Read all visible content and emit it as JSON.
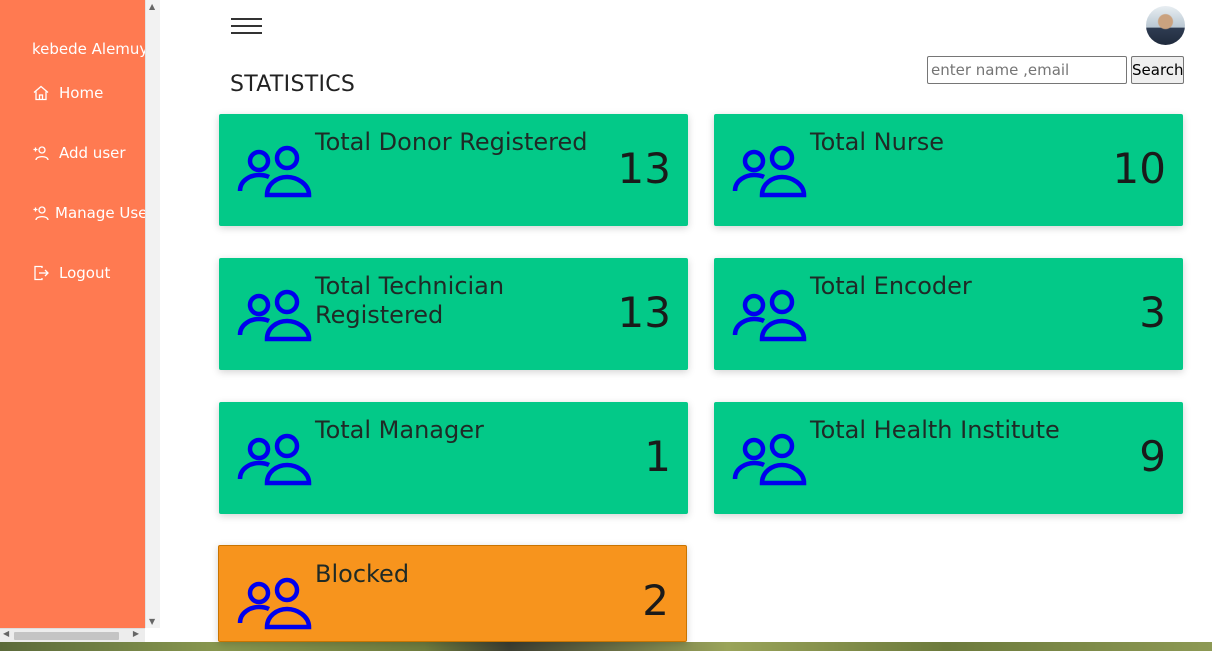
{
  "sidebar": {
    "username": "kebede Alemuyie",
    "items": [
      {
        "label": "Home",
        "icon": "home-icon"
      },
      {
        "label": "Add user",
        "icon": "add-user-icon"
      },
      {
        "label": "Manage Users",
        "icon": "manage-users-icon"
      },
      {
        "label": "Logout",
        "icon": "logout-icon"
      }
    ]
  },
  "header": {
    "title": "STATISTICS",
    "search_placeholder": "enter name ,email",
    "search_button": "Search"
  },
  "cards": [
    {
      "label": "Total Donor Registered",
      "count": "13",
      "icon": "users-icon"
    },
    {
      "label": "Total Nurse",
      "count": "10",
      "icon": "users-icon"
    },
    {
      "label": "Total Technician Registered",
      "count": "13",
      "icon": "users-icon"
    },
    {
      "label": "Total Encoder",
      "count": "3",
      "icon": "users-icon"
    },
    {
      "label": "Total Manager",
      "count": "1",
      "icon": "users-icon"
    },
    {
      "label": "Total Health Institute",
      "count": "9",
      "icon": "users-icon"
    },
    {
      "label": "Blocked",
      "count": "2",
      "icon": "users-icon"
    }
  ],
  "colors": {
    "sidebar": "#ff7a51",
    "card": "#03c988",
    "blocked_card": "#f7941d",
    "icon": "#0000ee"
  }
}
